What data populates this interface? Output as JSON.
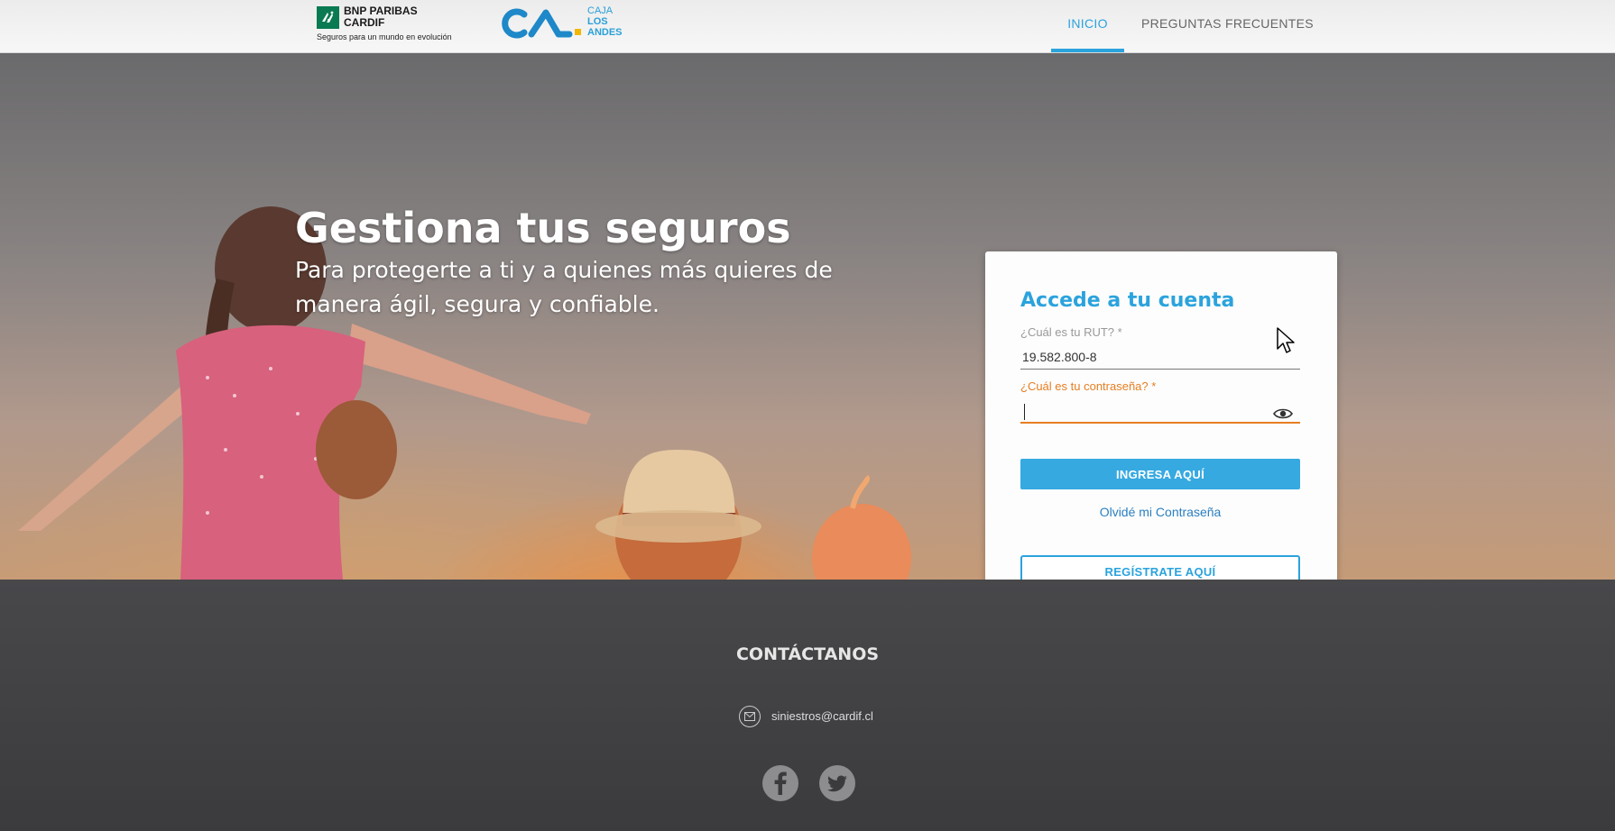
{
  "header": {
    "bnp_logo": {
      "name_line1": "BNP PARIBAS",
      "name_line2": "CARDIF",
      "tagline": "Seguros para un mundo en evolución"
    },
    "caja_logo": {
      "line1": "CAJA",
      "line2": "LOS",
      "line3": "ANDES"
    },
    "nav": {
      "home": "INICIO",
      "faq": "PREGUNTAS FRECUENTES"
    }
  },
  "hero": {
    "title": "Gestiona tus seguros",
    "subtitle": "Para protegerte a ti y a quienes más quieres de manera ágil, segura y confiable."
  },
  "login": {
    "title": "Accede a tu cuenta",
    "rut_label": "¿Cuál es tu RUT? *",
    "rut_value": "19.582.800-8",
    "password_label": "¿Cuál es tu contraseña? *",
    "password_value": "",
    "login_button": "INGRESA AQUÍ",
    "forgot_link": "Olvidé mi Contraseña",
    "register_button": "REGÍSTRATE AQUÍ"
  },
  "footer": {
    "title": "CONTÁCTANOS",
    "email": "siniestros@cardif.cl",
    "icons": [
      "mail-icon",
      "facebook-icon",
      "twitter-icon"
    ]
  },
  "colors": {
    "accent": "#2ba3dd",
    "active_field": "#e67e22",
    "bnp_green": "#0a7a52",
    "footer_bg": "#414043"
  }
}
